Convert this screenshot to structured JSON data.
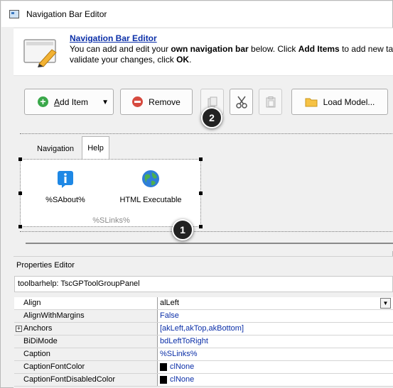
{
  "window": {
    "title": "Navigation Bar Editor"
  },
  "header": {
    "link": "Navigation Bar Editor",
    "desc_1a": "You can add and edit your ",
    "desc_1b": "own navigation bar",
    "desc_1c": " below. Click ",
    "desc_1d": "Add Items",
    "desc_1e": " to add new ta",
    "desc_2a": "validate your changes, click ",
    "desc_2b": "OK",
    "desc_2c": "."
  },
  "toolbar": {
    "add_accel": "A",
    "add_rest": "dd Item",
    "remove_label": "Remove",
    "load_label": "Load Model..."
  },
  "callouts": {
    "one": "1",
    "two": "2"
  },
  "designer": {
    "tabs": [
      {
        "label": "Navigation",
        "selected": false
      },
      {
        "label": "Help",
        "selected": true
      }
    ],
    "items": [
      {
        "label": "%SAbout%",
        "icon": "info-icon"
      },
      {
        "label": "HTML Executable",
        "icon": "globe-icon"
      }
    ],
    "panel_caption": "%SLinks%"
  },
  "properties": {
    "title": "Properties Editor",
    "component": "toolbarhelp: TscGPToolGroupPanel",
    "rows": [
      {
        "name": "Align",
        "value": "alLeft"
      },
      {
        "name": "AlignWithMargins",
        "value": "False"
      },
      {
        "name": "Anchors",
        "value": "[akLeft,akTop,akBottom]"
      },
      {
        "name": "BiDiMode",
        "value": "bdLeftToRight"
      },
      {
        "name": "Caption",
        "value": "%SLinks%"
      },
      {
        "name": "CaptionFontColor",
        "value": "clNone"
      },
      {
        "name": "CaptionFontDisabledColor",
        "value": "clNone"
      }
    ]
  },
  "colors": {
    "link": "#0b2fa8",
    "add": "#3aa84a",
    "remove": "#d64a3f",
    "info": "#1e88e5"
  }
}
